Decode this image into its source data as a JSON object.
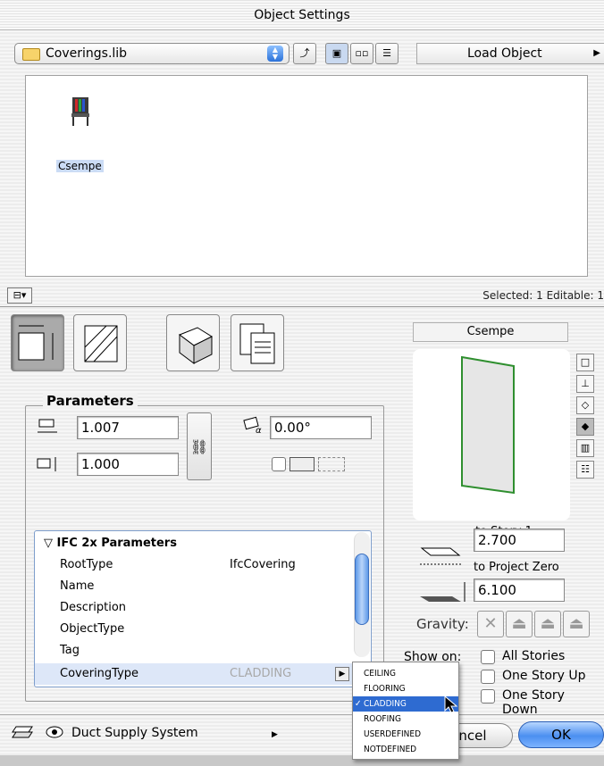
{
  "window": {
    "title": "Object Settings"
  },
  "toolbar": {
    "library_name": "Coverings.lib",
    "load_object_label": "Load Object"
  },
  "library": {
    "item_label": "Csempe"
  },
  "status": {
    "selected_text": "Selected: 1 Editable: 1"
  },
  "parameters": {
    "title": "Parameters",
    "width_value": "1.007",
    "height_value": "1.000",
    "angle_value": "0.00°"
  },
  "ifc": {
    "header": "IFC 2x Parameters",
    "rows": [
      {
        "key": "RootType",
        "value": "IfcCovering"
      },
      {
        "key": "Name",
        "value": ""
      },
      {
        "key": "Description",
        "value": ""
      },
      {
        "key": "ObjectType",
        "value": ""
      },
      {
        "key": "Tag",
        "value": ""
      },
      {
        "key": "CoveringType",
        "value": "CLADDING"
      }
    ]
  },
  "right_panel": {
    "object_name": "Csempe",
    "to_story_label": "to Story 1",
    "to_story_value": "2.700",
    "to_project_label": "to Project Zero",
    "to_project_value": "6.100",
    "gravity_label": "Gravity:",
    "show_on_label": "Show on:",
    "show_options": [
      "All Stories",
      "One Story Up",
      "One Story Down"
    ]
  },
  "menu": {
    "items": [
      "CEILING",
      "FLOORING",
      "CLADDING",
      "ROOFING",
      "USERDEFINED",
      "NOTDEFINED"
    ],
    "selected": "CLADDING",
    "check_glyph": "✓"
  },
  "bottom": {
    "layer_name": "Duct Supply System",
    "cancel_label": "ncel",
    "ok_label": "OK"
  },
  "colors": {
    "accent": "#2e6bd1",
    "preview_edge": "#2f8f2f"
  }
}
